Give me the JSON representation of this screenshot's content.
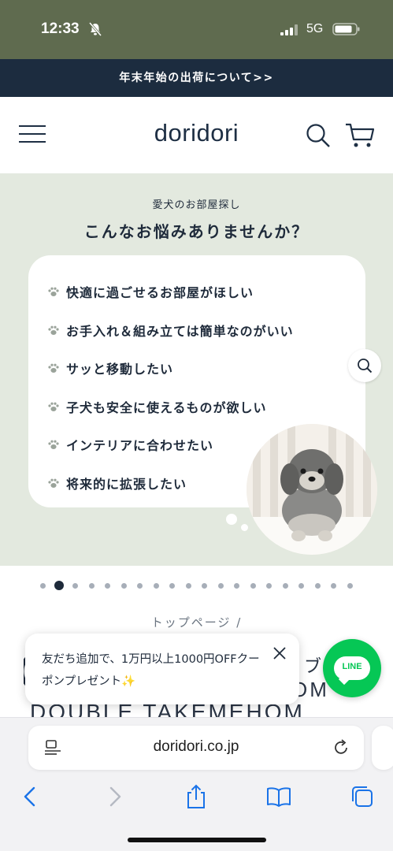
{
  "status_bar": {
    "time": "12:33",
    "network": "5G",
    "background": "#5f6b4f",
    "icons": [
      "bell-muted-icon",
      "signal-icon",
      "battery-icon"
    ]
  },
  "announcement": {
    "text": "年末年始の出荷について>>",
    "background": "#1c2c3f"
  },
  "header": {
    "logo": "doridori",
    "icons": [
      "menu-icon",
      "search-icon",
      "cart-icon"
    ]
  },
  "hero": {
    "background": "#e3e9df",
    "subtitle": "愛犬のお部屋探し",
    "title": "こんなお悩みありませんか？",
    "checklist": [
      "快適に過ごせるお部屋がほしい",
      "お手入れ＆組み立ては簡単なのがいい",
      "サッと移動したい",
      "子犬も安全に使えるものが欲しい",
      "インテリアに合わせたい",
      "将来的に拡張したい"
    ],
    "icons": [
      "paw-icon",
      "zoom-icon"
    ]
  },
  "carousel": {
    "total": 20,
    "active_index": 1
  },
  "breadcrumb": "トップページ /",
  "product_partial": {
    "line1": "ブ",
    "line2": "OM",
    "line3": "DOUBLE TAKEMEHOM"
  },
  "toast": {
    "text": "友だち追加で、1万円以上1000円OFFクーポンプレゼント✨",
    "icon": "close-icon"
  },
  "line_button": {
    "label": "LINE",
    "color": "#06c755"
  },
  "browser": {
    "url": "doridori.co.jp",
    "icons": [
      "reader-icon",
      "reload-icon",
      "back-icon",
      "forward-icon",
      "share-icon",
      "bookmarks-icon",
      "tabs-icon"
    ],
    "accent": "#1a73e8"
  }
}
